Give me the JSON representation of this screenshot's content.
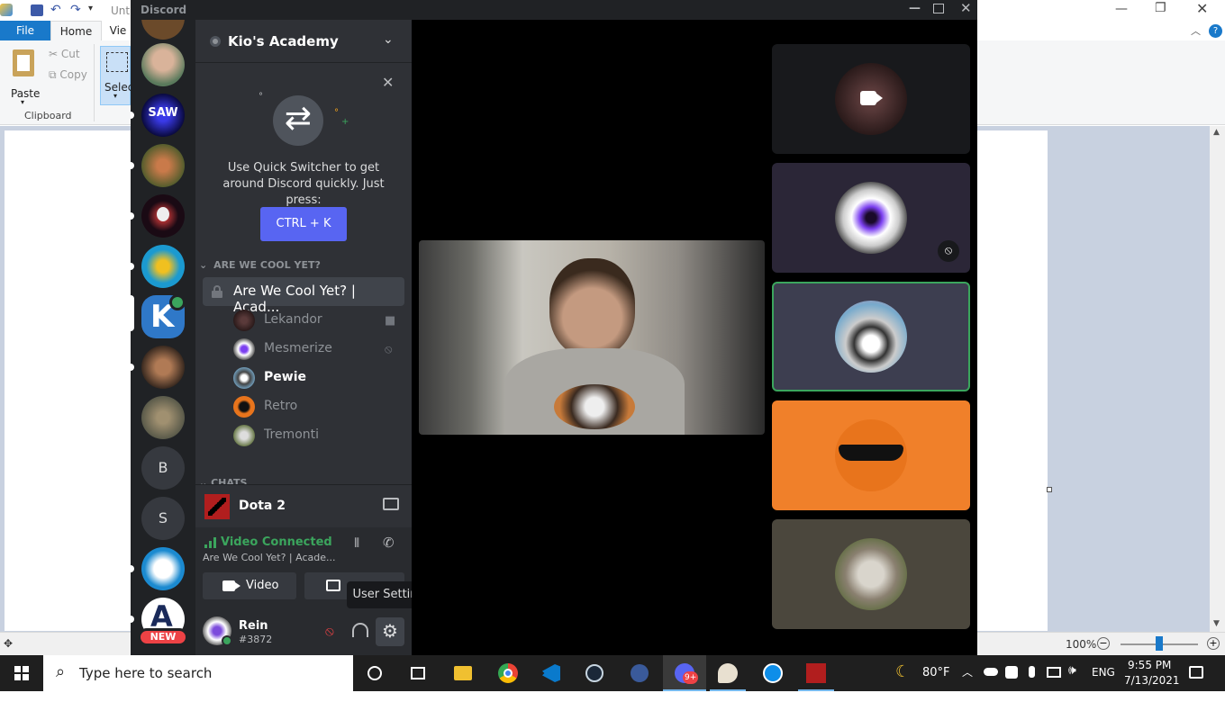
{
  "paint": {
    "doc_title": "Unti",
    "tabs": {
      "file": "File",
      "home": "Home",
      "view": "Vie"
    },
    "clipboard": {
      "paste": "Paste",
      "cut": "Cut",
      "copy": "Copy",
      "group": "Clipboard"
    },
    "select_label": "Select",
    "zoom": "100%"
  },
  "discord": {
    "app_name": "Discord",
    "server_name": "Kio's Academy",
    "quick_switcher": {
      "text": "Use Quick Switcher to get around Discord quickly. Just press:",
      "shortcut": "CTRL + K"
    },
    "category": "ARE WE COOL YET?",
    "voice_channel": "Are We Cool Yet? | Acad...",
    "members": [
      {
        "name": "Lekandor",
        "color": "#8e9297",
        "icon": "video-icon"
      },
      {
        "name": "Mesmerize",
        "color": "#8e9297",
        "icon": "mic-muted-icon"
      },
      {
        "name": "Pewie",
        "color": "#ffffff",
        "icon": ""
      },
      {
        "name": "Retro",
        "color": "#8e9297",
        "icon": ""
      },
      {
        "name": "Tremonti",
        "color": "#8e9297",
        "icon": ""
      }
    ],
    "chats_category": "CHATS",
    "activity": "Dota 2",
    "voice_status": "Video Connected",
    "voice_status_channel": "Are We Cool Yet? | Acade...",
    "video_button": "Video",
    "tooltip": "User Settings",
    "user": {
      "name": "Rein",
      "tag": "#3872"
    },
    "guild_letters": [
      "B",
      "S"
    ],
    "new_badge": "NEW"
  },
  "taskbar": {
    "search_placeholder": "Type here to search",
    "weather": "80°F",
    "language": "ENG",
    "time": "9:55 PM",
    "date": "7/13/2021",
    "badge": "9+"
  },
  "colors": {
    "discord_bg": "#2f3136",
    "blurple": "#5865f2",
    "green": "#3ba55d",
    "orange_tile": "#f0802a"
  }
}
